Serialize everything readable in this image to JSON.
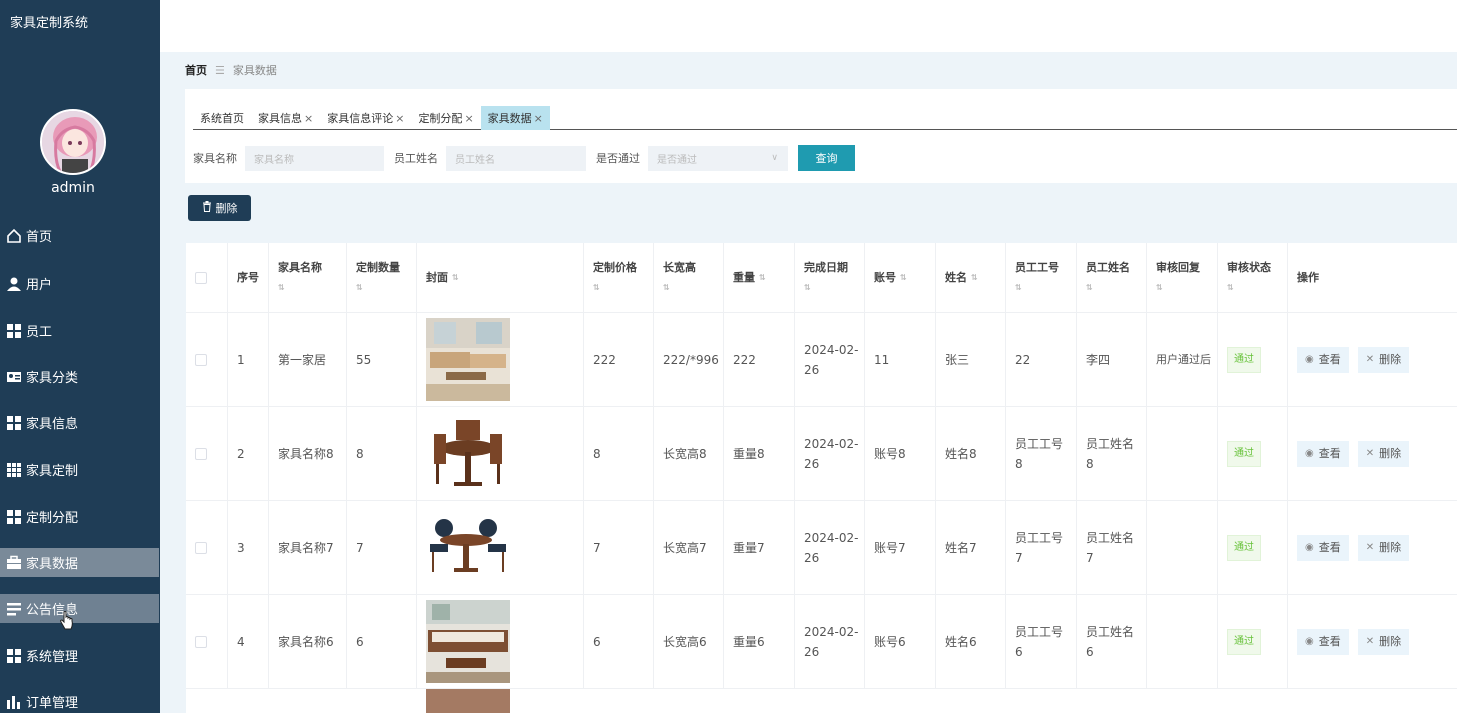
{
  "app": {
    "title": "家具定制系统",
    "username": "admin"
  },
  "sidebar": {
    "items": [
      {
        "label": "首页",
        "icon": "home-icon"
      },
      {
        "label": "用户",
        "icon": "user-icon"
      },
      {
        "label": "员工",
        "icon": "grid-icon"
      },
      {
        "label": "家具分类",
        "icon": "id-card-icon"
      },
      {
        "label": "家具信息",
        "icon": "grid-icon"
      },
      {
        "label": "家具定制",
        "icon": "grid-nine-icon"
      },
      {
        "label": "定制分配",
        "icon": "grid-icon"
      },
      {
        "label": "家具数据",
        "icon": "briefcase-icon"
      },
      {
        "label": "公告信息",
        "icon": "list-icon"
      },
      {
        "label": "系统管理",
        "icon": "grid-icon"
      },
      {
        "label": "订单管理",
        "icon": "bar-chart-icon"
      }
    ],
    "active": "家具数据",
    "accent": "#1f3d56"
  },
  "breadcrumb": {
    "home": "首页",
    "current": "家具数据"
  },
  "tabs": [
    {
      "label": "系统首页",
      "closable": false
    },
    {
      "label": "家具信息",
      "closable": true
    },
    {
      "label": "家具信息评论",
      "closable": true
    },
    {
      "label": "定制分配",
      "closable": true
    },
    {
      "label": "家具数据",
      "closable": true,
      "active": true
    }
  ],
  "search": {
    "furniture_label": "家具名称",
    "furniture_placeholder": "家具名称",
    "staff_label": "员工姓名",
    "staff_placeholder": "员工姓名",
    "passed_label": "是否通过",
    "passed_placeholder": "是否通过",
    "query_button": "查询"
  },
  "toolbar": {
    "delete_button": "删除"
  },
  "table": {
    "headers": [
      "序号",
      "家具名称",
      "定制数量",
      "封面",
      "定制价格",
      "长宽高",
      "重量",
      "完成日期",
      "账号",
      "姓名",
      "员工工号",
      "员工姓名",
      "审核回复",
      "审核状态",
      "操作"
    ],
    "view_label": "查看",
    "delete_label": "删除",
    "rows": [
      {
        "no": "1",
        "name": "第一家居",
        "qty": "55",
        "price": "222",
        "dims": "222/*996",
        "weight": "222",
        "date1": "2024-02-",
        "date2": "26",
        "account": "11",
        "person": "张三",
        "staff_id": "22",
        "staff_id2": "",
        "staff_name": "李四",
        "staff_name2": "",
        "reply": "用户通过后",
        "status": "通过",
        "img": "sofa"
      },
      {
        "no": "2",
        "name": "家具名称8",
        "qty": "8",
        "price": "8",
        "dims": "长宽高8",
        "weight": "重量8",
        "date1": "2024-02-",
        "date2": "26",
        "account": "账号8",
        "person": "姓名8",
        "staff_id": "员工工号",
        "staff_id2": "8",
        "staff_name": "员工姓名",
        "staff_name2": "8",
        "reply": "",
        "status": "通过",
        "img": "table"
      },
      {
        "no": "3",
        "name": "家具名称7",
        "qty": "7",
        "price": "7",
        "dims": "长宽高7",
        "weight": "重量7",
        "date1": "2024-02-",
        "date2": "26",
        "account": "账号7",
        "person": "姓名7",
        "staff_id": "员工工号",
        "staff_id2": "7",
        "staff_name": "员工姓名",
        "staff_name2": "7",
        "reply": "",
        "status": "通过",
        "img": "chairs"
      },
      {
        "no": "4",
        "name": "家具名称6",
        "qty": "6",
        "price": "6",
        "dims": "长宽高6",
        "weight": "重量6",
        "date1": "2024-02-",
        "date2": "26",
        "account": "账号6",
        "person": "姓名6",
        "staff_id": "员工工号",
        "staff_id2": "6",
        "staff_name": "员工姓名",
        "staff_name2": "6",
        "reply": "",
        "status": "通过",
        "img": "livingroom"
      }
    ]
  }
}
